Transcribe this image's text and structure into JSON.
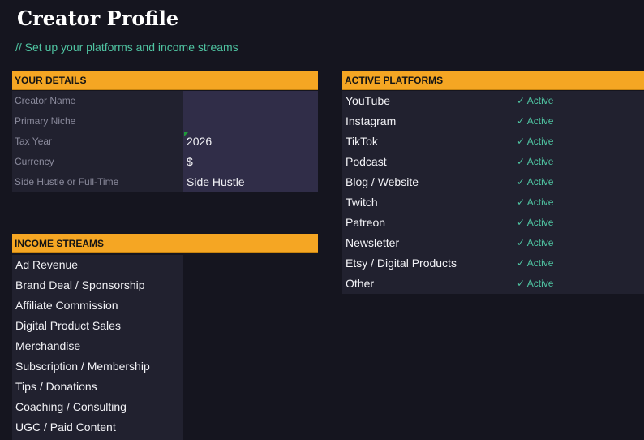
{
  "title": "Creator Profile",
  "subtitle": "// Set up your platforms and income streams",
  "details": {
    "header": "YOUR DETAILS",
    "rows": [
      {
        "label": "Creator Name",
        "value": ""
      },
      {
        "label": "Primary Niche",
        "value": ""
      },
      {
        "label": "Tax Year",
        "value": "2026"
      },
      {
        "label": "Currency",
        "value": "$"
      },
      {
        "label": "Side Hustle or Full-Time",
        "value": "Side Hustle"
      }
    ]
  },
  "income": {
    "header": "INCOME STREAMS",
    "items": [
      "Ad Revenue",
      "Brand Deal / Sponsorship",
      "Affiliate Commission",
      "Digital Product Sales",
      "Merchandise",
      "Subscription / Membership",
      "Tips / Donations",
      "Coaching / Consulting",
      "UGC / Paid Content"
    ]
  },
  "platforms": {
    "header": "ACTIVE PLATFORMS",
    "items": [
      {
        "name": "YouTube",
        "status": "✓ Active"
      },
      {
        "name": "Instagram",
        "status": "✓ Active"
      },
      {
        "name": "TikTok",
        "status": "✓ Active"
      },
      {
        "name": "Podcast",
        "status": "✓ Active"
      },
      {
        "name": "Blog / Website",
        "status": "✓ Active"
      },
      {
        "name": "Twitch",
        "status": "✓ Active"
      },
      {
        "name": "Patreon",
        "status": "✓ Active"
      },
      {
        "name": "Newsletter",
        "status": "✓ Active"
      },
      {
        "name": "Etsy / Digital Products",
        "status": "✓ Active"
      },
      {
        "name": "Other",
        "status": "✓ Active"
      }
    ]
  },
  "colors": {
    "background": "#15151f",
    "header": "#f5a623",
    "active": "#4fc3a1",
    "input_cell": "#302d48"
  }
}
